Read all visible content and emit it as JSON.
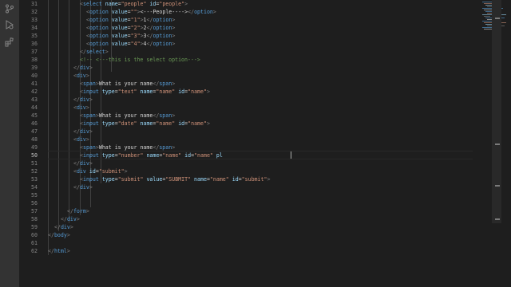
{
  "editor": {
    "active_line": "50",
    "lines": [
      {
        "n": "31",
        "indent": 10,
        "parts": [
          [
            "t",
            "<"
          ],
          [
            "tag",
            "select"
          ],
          [
            "txt",
            " "
          ],
          [
            "attr",
            "name"
          ],
          [
            "txt",
            "="
          ],
          [
            "str",
            "\"people\""
          ],
          [
            "txt",
            " "
          ],
          [
            "attr",
            "id"
          ],
          [
            "txt",
            "="
          ],
          [
            "str",
            "\"people\""
          ],
          [
            "t",
            ">"
          ]
        ]
      },
      {
        "n": "32",
        "indent": 12,
        "parts": [
          [
            "t",
            "<"
          ],
          [
            "tag",
            "option"
          ],
          [
            "txt",
            " "
          ],
          [
            "attr",
            "value"
          ],
          [
            "txt",
            "="
          ],
          [
            "str",
            "\"\""
          ],
          [
            "t",
            ">"
          ],
          [
            "txt",
            "<---People---->"
          ],
          [
            "t",
            "</"
          ],
          [
            "tag",
            "option"
          ],
          [
            "t",
            ">"
          ]
        ]
      },
      {
        "n": "33",
        "indent": 12,
        "parts": [
          [
            "t",
            "<"
          ],
          [
            "tag",
            "option"
          ],
          [
            "txt",
            " "
          ],
          [
            "attr",
            "value"
          ],
          [
            "txt",
            "="
          ],
          [
            "str",
            "\"1\""
          ],
          [
            "t",
            ">"
          ],
          [
            "txt",
            "1"
          ],
          [
            "t",
            "</"
          ],
          [
            "tag",
            "option"
          ],
          [
            "t",
            ">"
          ]
        ]
      },
      {
        "n": "34",
        "indent": 12,
        "parts": [
          [
            "t",
            "<"
          ],
          [
            "tag",
            "option"
          ],
          [
            "txt",
            " "
          ],
          [
            "attr",
            "value"
          ],
          [
            "txt",
            "="
          ],
          [
            "str",
            "\"2\""
          ],
          [
            "t",
            ">"
          ],
          [
            "txt",
            "2"
          ],
          [
            "t",
            "</"
          ],
          [
            "tag",
            "option"
          ],
          [
            "t",
            ">"
          ]
        ]
      },
      {
        "n": "35",
        "indent": 12,
        "parts": [
          [
            "t",
            "<"
          ],
          [
            "tag",
            "option"
          ],
          [
            "txt",
            " "
          ],
          [
            "attr",
            "value"
          ],
          [
            "txt",
            "="
          ],
          [
            "str",
            "\"3\""
          ],
          [
            "t",
            ">"
          ],
          [
            "txt",
            "3"
          ],
          [
            "t",
            "</"
          ],
          [
            "tag",
            "option"
          ],
          [
            "t",
            ">"
          ]
        ]
      },
      {
        "n": "36",
        "indent": 12,
        "parts": [
          [
            "t",
            "<"
          ],
          [
            "tag",
            "option"
          ],
          [
            "txt",
            " "
          ],
          [
            "attr",
            "value"
          ],
          [
            "txt",
            "="
          ],
          [
            "str",
            "\"4\""
          ],
          [
            "t",
            ">"
          ],
          [
            "txt",
            "4"
          ],
          [
            "t",
            "</"
          ],
          [
            "tag",
            "option"
          ],
          [
            "t",
            ">"
          ]
        ]
      },
      {
        "n": "37",
        "indent": 10,
        "parts": [
          [
            "t",
            "</"
          ],
          [
            "tag",
            "select"
          ],
          [
            "t",
            ">"
          ]
        ]
      },
      {
        "n": "38",
        "indent": 10,
        "parts": [
          [
            "cmt",
            "<!-- <---this is the select option---> "
          ]
        ]
      },
      {
        "n": "39",
        "indent": 8,
        "parts": [
          [
            "t",
            "</"
          ],
          [
            "tag",
            "div"
          ],
          [
            "t",
            ">"
          ]
        ]
      },
      {
        "n": "40",
        "indent": 8,
        "parts": [
          [
            "t",
            "<"
          ],
          [
            "tag",
            "div"
          ],
          [
            "t",
            ">"
          ]
        ]
      },
      {
        "n": "41",
        "indent": 10,
        "parts": [
          [
            "t",
            "<"
          ],
          [
            "tag",
            "span"
          ],
          [
            "t",
            ">"
          ],
          [
            "txt",
            "What is your name"
          ],
          [
            "t",
            "</"
          ],
          [
            "tag",
            "span"
          ],
          [
            "t",
            ">"
          ]
        ]
      },
      {
        "n": "42",
        "indent": 10,
        "parts": [
          [
            "t",
            "<"
          ],
          [
            "tag",
            "input"
          ],
          [
            "txt",
            " "
          ],
          [
            "attr",
            "type"
          ],
          [
            "txt",
            "="
          ],
          [
            "str",
            "\"text\""
          ],
          [
            "txt",
            " "
          ],
          [
            "attr",
            "name"
          ],
          [
            "txt",
            "="
          ],
          [
            "str",
            "\"name\""
          ],
          [
            "txt",
            " "
          ],
          [
            "attr",
            "id"
          ],
          [
            "txt",
            "="
          ],
          [
            "str",
            "\"name\""
          ],
          [
            "t",
            ">"
          ]
        ]
      },
      {
        "n": "43",
        "indent": 8,
        "parts": [
          [
            "t",
            "</"
          ],
          [
            "tag",
            "div"
          ],
          [
            "t",
            ">"
          ]
        ]
      },
      {
        "n": "44",
        "indent": 8,
        "parts": [
          [
            "t",
            "<"
          ],
          [
            "tag",
            "div"
          ],
          [
            "t",
            ">"
          ]
        ]
      },
      {
        "n": "45",
        "indent": 10,
        "parts": [
          [
            "t",
            "<"
          ],
          [
            "tag",
            "span"
          ],
          [
            "t",
            ">"
          ],
          [
            "txt",
            "What is your name"
          ],
          [
            "t",
            "</"
          ],
          [
            "tag",
            "span"
          ],
          [
            "t",
            ">"
          ]
        ]
      },
      {
        "n": "46",
        "indent": 10,
        "parts": [
          [
            "t",
            "<"
          ],
          [
            "tag",
            "input"
          ],
          [
            "txt",
            " "
          ],
          [
            "attr",
            "type"
          ],
          [
            "txt",
            "="
          ],
          [
            "str",
            "\"date\""
          ],
          [
            "txt",
            " "
          ],
          [
            "attr",
            "name"
          ],
          [
            "txt",
            "="
          ],
          [
            "str",
            "\"name\""
          ],
          [
            "txt",
            " "
          ],
          [
            "attr",
            "id"
          ],
          [
            "txt",
            "="
          ],
          [
            "str",
            "\"name\""
          ],
          [
            "t",
            ">"
          ]
        ]
      },
      {
        "n": "47",
        "indent": 8,
        "parts": [
          [
            "t",
            "</"
          ],
          [
            "tag",
            "div"
          ],
          [
            "t",
            ">"
          ]
        ]
      },
      {
        "n": "48",
        "indent": 8,
        "parts": [
          [
            "t",
            "<"
          ],
          [
            "tag",
            "div"
          ],
          [
            "t",
            ">"
          ]
        ]
      },
      {
        "n": "49",
        "indent": 10,
        "parts": [
          [
            "t",
            "<"
          ],
          [
            "tag",
            "span"
          ],
          [
            "t",
            ">"
          ],
          [
            "txt",
            "What is your name"
          ],
          [
            "t",
            "</"
          ],
          [
            "tag",
            "span"
          ],
          [
            "t",
            ">"
          ]
        ]
      },
      {
        "n": "50",
        "indent": 10,
        "parts": [
          [
            "t",
            "<"
          ],
          [
            "tag",
            "input"
          ],
          [
            "txt",
            " "
          ],
          [
            "attr",
            "type"
          ],
          [
            "txt",
            "="
          ],
          [
            "str",
            "\"number\""
          ],
          [
            "txt",
            " "
          ],
          [
            "attr",
            "name"
          ],
          [
            "txt",
            "="
          ],
          [
            "str",
            "\"name\""
          ],
          [
            "txt",
            " "
          ],
          [
            "attr",
            "id"
          ],
          [
            "txt",
            "="
          ],
          [
            "str",
            "\"name\""
          ],
          [
            "txt",
            " "
          ],
          [
            "attr",
            "pl"
          ]
        ]
      },
      {
        "n": "51",
        "indent": 8,
        "parts": [
          [
            "t",
            "</"
          ],
          [
            "tag",
            "div"
          ],
          [
            "t",
            ">"
          ]
        ]
      },
      {
        "n": "52",
        "indent": 8,
        "parts": [
          [
            "t",
            "<"
          ],
          [
            "tag",
            "div"
          ],
          [
            "txt",
            " "
          ],
          [
            "attr",
            "id"
          ],
          [
            "txt",
            "="
          ],
          [
            "str",
            "\"submit\""
          ],
          [
            "t",
            ">"
          ]
        ]
      },
      {
        "n": "53",
        "indent": 10,
        "parts": [
          [
            "t",
            "<"
          ],
          [
            "tag",
            "input"
          ],
          [
            "txt",
            " "
          ],
          [
            "attr",
            "type"
          ],
          [
            "txt",
            "="
          ],
          [
            "str",
            "\"submit\""
          ],
          [
            "txt",
            " "
          ],
          [
            "attr",
            "value"
          ],
          [
            "txt",
            "="
          ],
          [
            "str",
            "\"SUBMIT\""
          ],
          [
            "txt",
            " "
          ],
          [
            "attr",
            "name"
          ],
          [
            "txt",
            "="
          ],
          [
            "str",
            "\"name\""
          ],
          [
            "txt",
            " "
          ],
          [
            "attr",
            "id"
          ],
          [
            "txt",
            "="
          ],
          [
            "str",
            "\"submit\""
          ],
          [
            "t",
            ">"
          ]
        ]
      },
      {
        "n": "54",
        "indent": 8,
        "parts": [
          [
            "t",
            "</"
          ],
          [
            "tag",
            "div"
          ],
          [
            "t",
            ">"
          ]
        ]
      },
      {
        "n": "55",
        "indent": 0,
        "parts": []
      },
      {
        "n": "56",
        "indent": 0,
        "parts": []
      },
      {
        "n": "57",
        "indent": 6,
        "parts": [
          [
            "t",
            "</"
          ],
          [
            "tag",
            "form"
          ],
          [
            "t",
            ">"
          ]
        ]
      },
      {
        "n": "58",
        "indent": 4,
        "parts": [
          [
            "t",
            "</"
          ],
          [
            "tag",
            "div"
          ],
          [
            "t",
            ">"
          ]
        ]
      },
      {
        "n": "59",
        "indent": 2,
        "parts": [
          [
            "t",
            "</"
          ],
          [
            "tag",
            "div"
          ],
          [
            "t",
            ">"
          ]
        ]
      },
      {
        "n": "60",
        "indent": 0,
        "parts": [
          [
            "t",
            "</"
          ],
          [
            "tag",
            "body"
          ],
          [
            "t",
            ">"
          ]
        ]
      },
      {
        "n": "61",
        "indent": 0,
        "parts": []
      },
      {
        "n": "62",
        "indent": 0,
        "parts": [
          [
            "t",
            "</"
          ],
          [
            "tag",
            "html"
          ],
          [
            "t",
            ">"
          ]
        ]
      }
    ]
  },
  "activity_bar": {
    "icons": [
      "source-control-icon",
      "run-debug-icon",
      "extensions-icon"
    ]
  }
}
